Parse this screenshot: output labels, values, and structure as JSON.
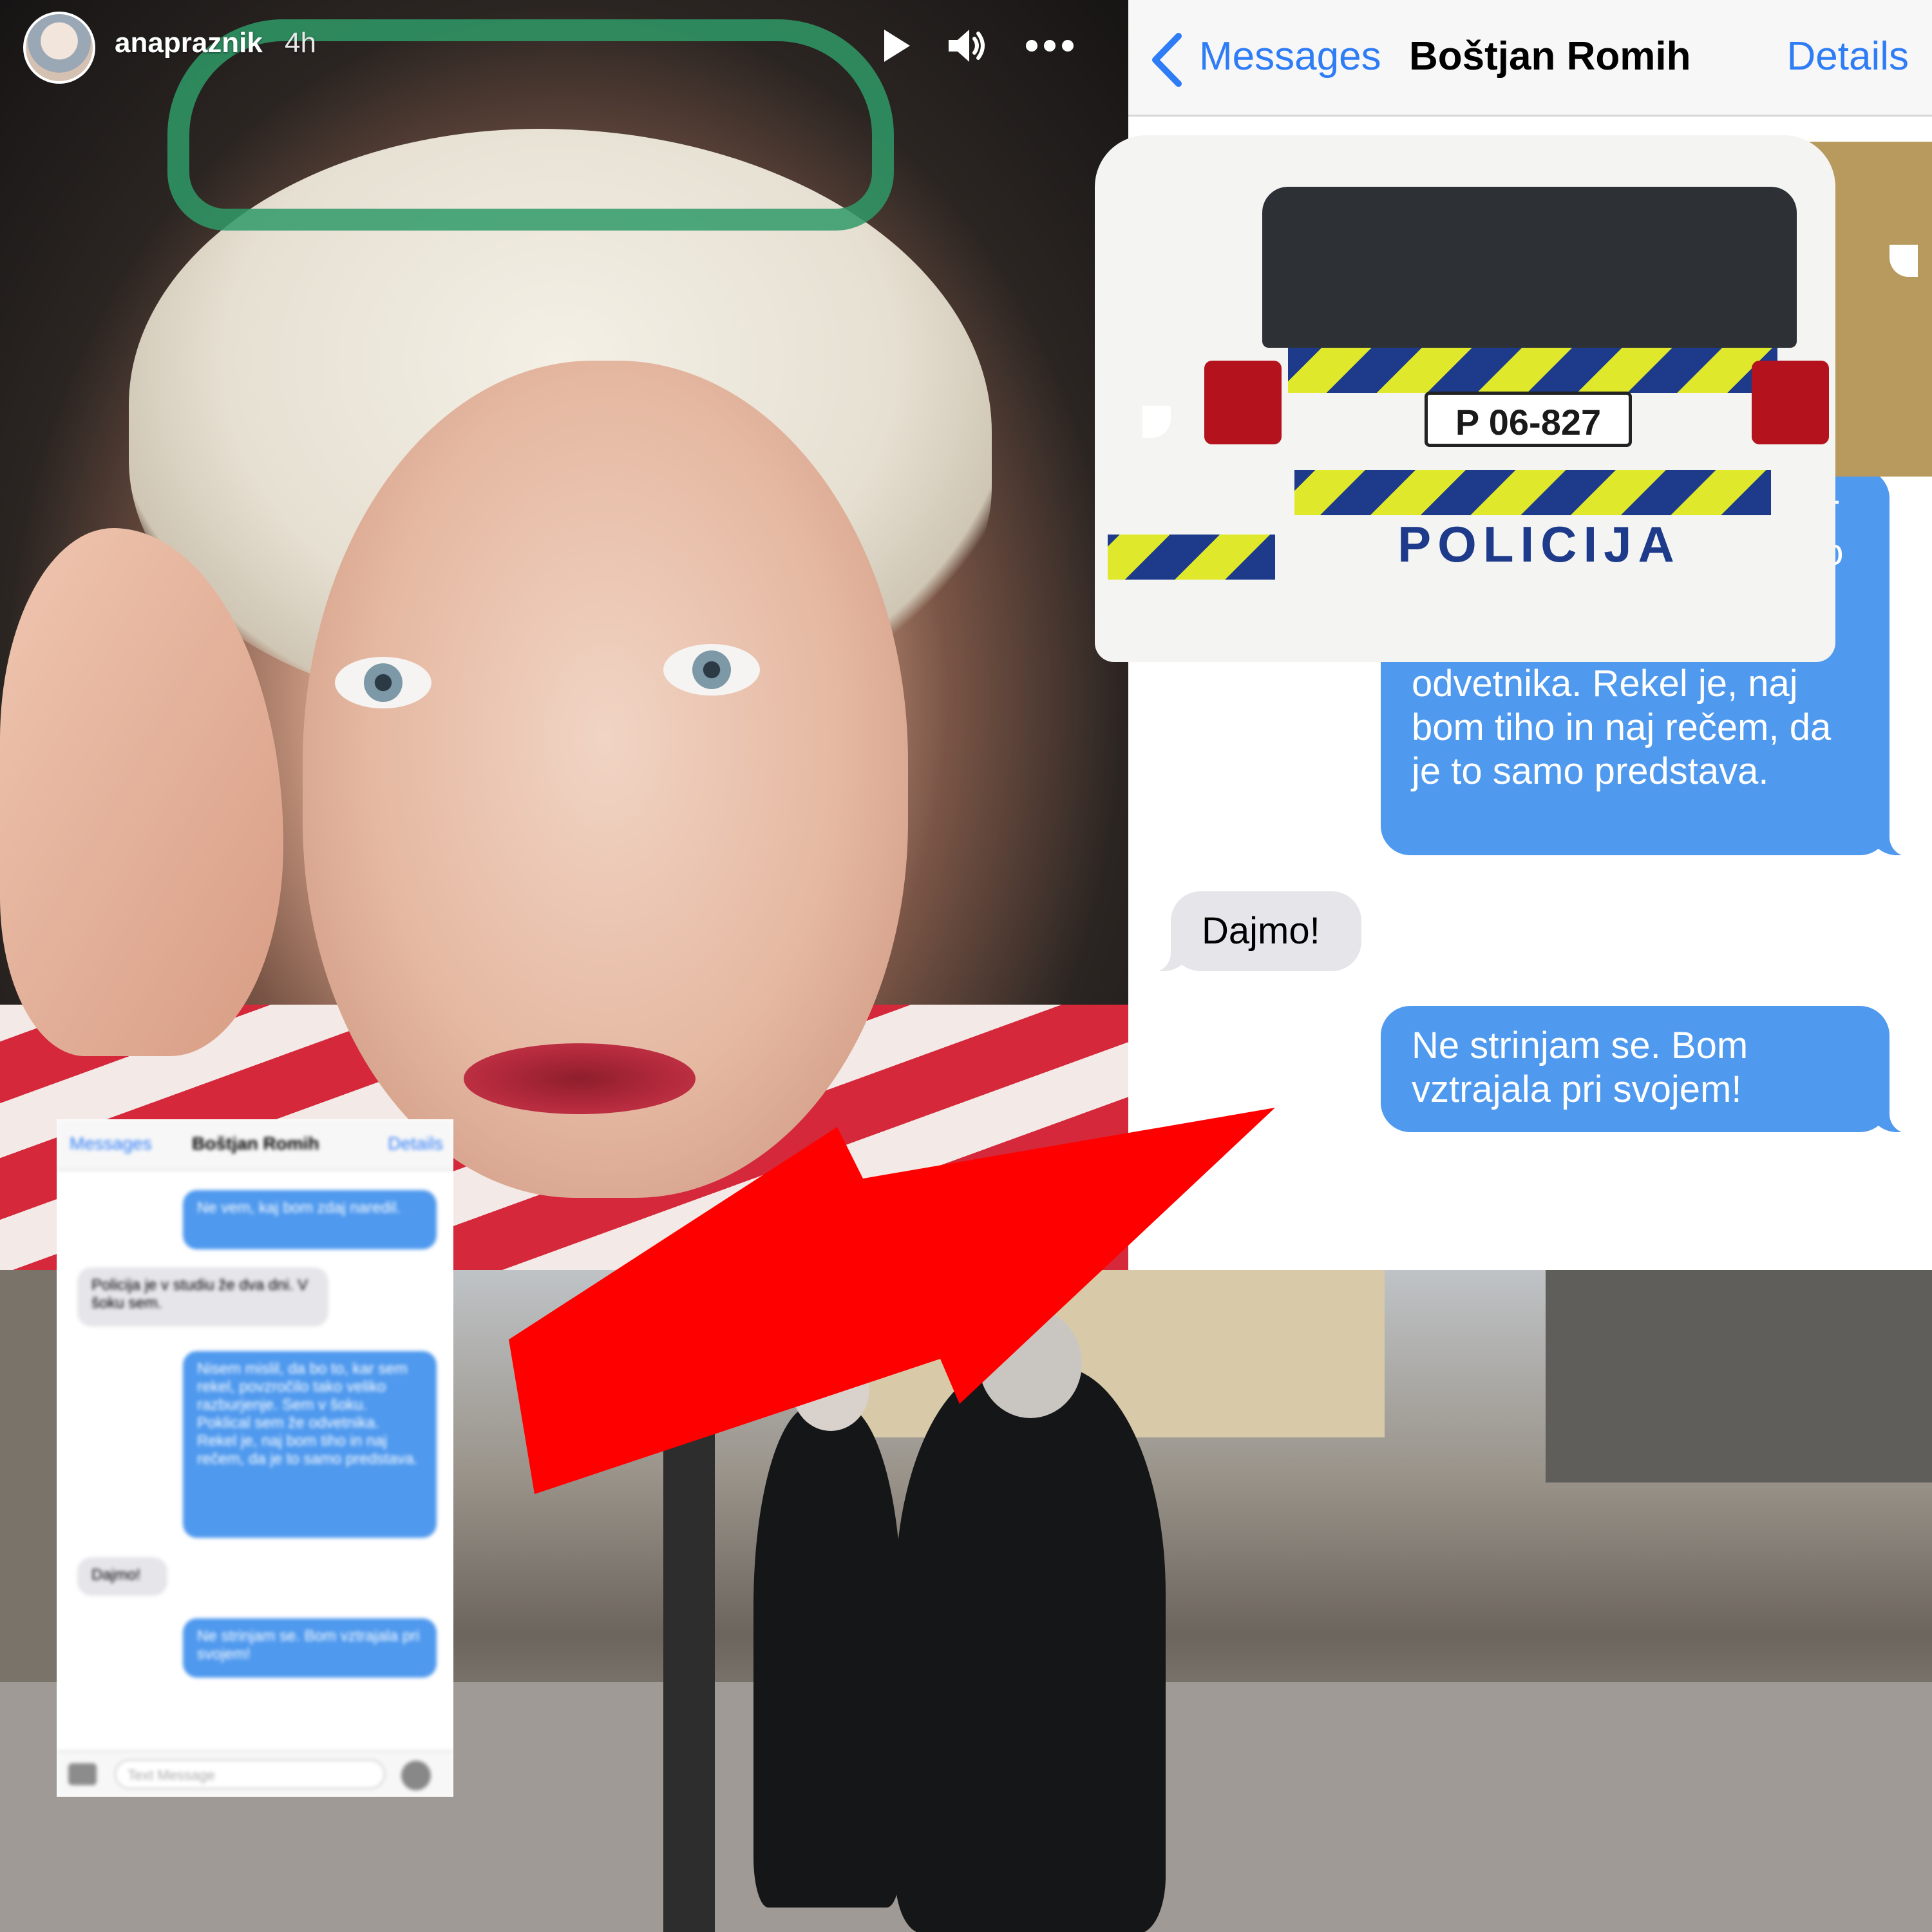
{
  "story": {
    "username": "anapraznik",
    "time_ago": "4h",
    "icons": [
      "play-icon",
      "volume-icon",
      "more-options-icon"
    ]
  },
  "imessage": {
    "nav": {
      "back_label": "Messages",
      "contact_name": "Boštjan Romih",
      "details_label": "Details"
    },
    "messages": [
      {
        "direction": "out",
        "text": "Ne vem, kaj bom zdaj naredil."
      },
      {
        "direction": "in",
        "text": "Policija je v studiu že dva dni. V šoku sem."
      },
      {
        "direction": "out",
        "text": "Nisem mislil, da bo to, kar sem rekel, povzročilo tako veliko razburjenje. Sem v šoku. Poklical sem že odvetnika. Rekel je, naj bom tiho in naj rečem, da je to samo predstava."
      },
      {
        "direction": "in",
        "text": "Dajmo!"
      },
      {
        "direction": "out",
        "text": "Ne strinjam se. Bom vztrajala pri svojem!"
      }
    ]
  },
  "thumbnail": {
    "back_label": "Messages",
    "contact_name": "Boštjan Romih",
    "details_label": "Details",
    "input_placeholder": "Text Message"
  },
  "police_car": {
    "plate": "P 06-827",
    "label": "POLICIJA"
  },
  "colors": {
    "imessage_blue": "#4f99ee",
    "imessage_gray": "#e6e5ea",
    "link_blue": "#2e7cf6",
    "arrow_red": "#ff0000"
  }
}
